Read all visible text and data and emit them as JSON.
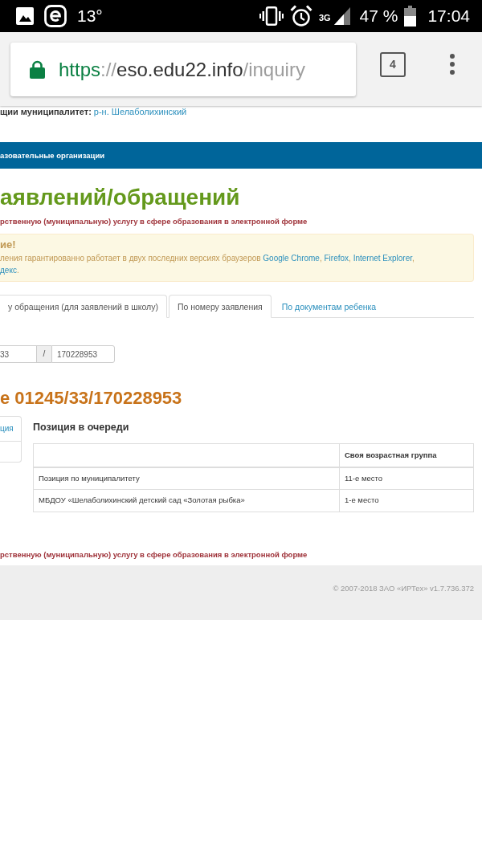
{
  "status_bar": {
    "temperature": "13°",
    "network": "3G",
    "battery": "47 %",
    "time": "17:04"
  },
  "browser": {
    "url": [
      {
        "text": "https",
        "kind": "scheme"
      },
      {
        "text": "://",
        "kind": "separator"
      },
      {
        "text": "eso.edu22.info",
        "kind": "host"
      },
      {
        "text": "/inquiry",
        "kind": "path"
      }
    ],
    "tab_count": "4"
  },
  "municipality": {
    "label": "щии муниципалитет:",
    "value": "р-н. Шелаболихинский"
  },
  "nav_bar": {
    "item": "азовательные организации"
  },
  "page_title": "аявлений/обращений",
  "subtitle": "рственную (муниципальную) услугу в сфере образования в электронной форме",
  "alert": {
    "title": "ие!",
    "lines": [
      [
        {
          "text": "ления гарантированно работает в двух последних версиях браузеров ",
          "kind": "text"
        },
        {
          "text": "Google Chrome",
          "kind": "link"
        },
        {
          "text": ", ",
          "kind": "text"
        },
        {
          "text": "Firefox",
          "kind": "link"
        },
        {
          "text": ", ",
          "kind": "text"
        },
        {
          "text": "Internet Explorer",
          "kind": "link"
        },
        {
          "text": ",",
          "kind": "text"
        }
      ],
      [
        {
          "text": "декс",
          "kind": "link"
        },
        {
          "text": ".",
          "kind": "text"
        }
      ]
    ]
  },
  "search_tabs": [
    {
      "label": "у обращения (для заявлений в школу)",
      "selected": true
    },
    {
      "label": "По номеру заявления",
      "selected": true
    },
    {
      "label": "По документам ребенка",
      "selected": false
    }
  ],
  "search_form": {
    "fields": [
      {
        "value": "33"
      },
      {
        "value": "170228953"
      }
    ],
    "separator": "/"
  },
  "result": {
    "title": "е 01245/33/170228953",
    "sidebar": {
      "items": [
        {
          "label": "ция"
        }
      ]
    },
    "section_title": "Позиция в очереди",
    "table": {
      "columns": [
        {
          "label": "Своя возрастная группа"
        }
      ],
      "rows": [
        {
          "label": "Позиция по муниципалитету",
          "cells": [
            "11-е место"
          ]
        },
        {
          "label": "МБДОУ «Шелаболихинский детский сад «Золотая рыбка»",
          "cells": [
            "1-е место"
          ]
        }
      ]
    }
  },
  "footer_subtitle": "рственную (муниципальную) услугу в сфере образования в электронной форме",
  "footer": {
    "copyright": "© 2007-2018 ЗАО «ИРТех» v1.7.736.372"
  }
}
